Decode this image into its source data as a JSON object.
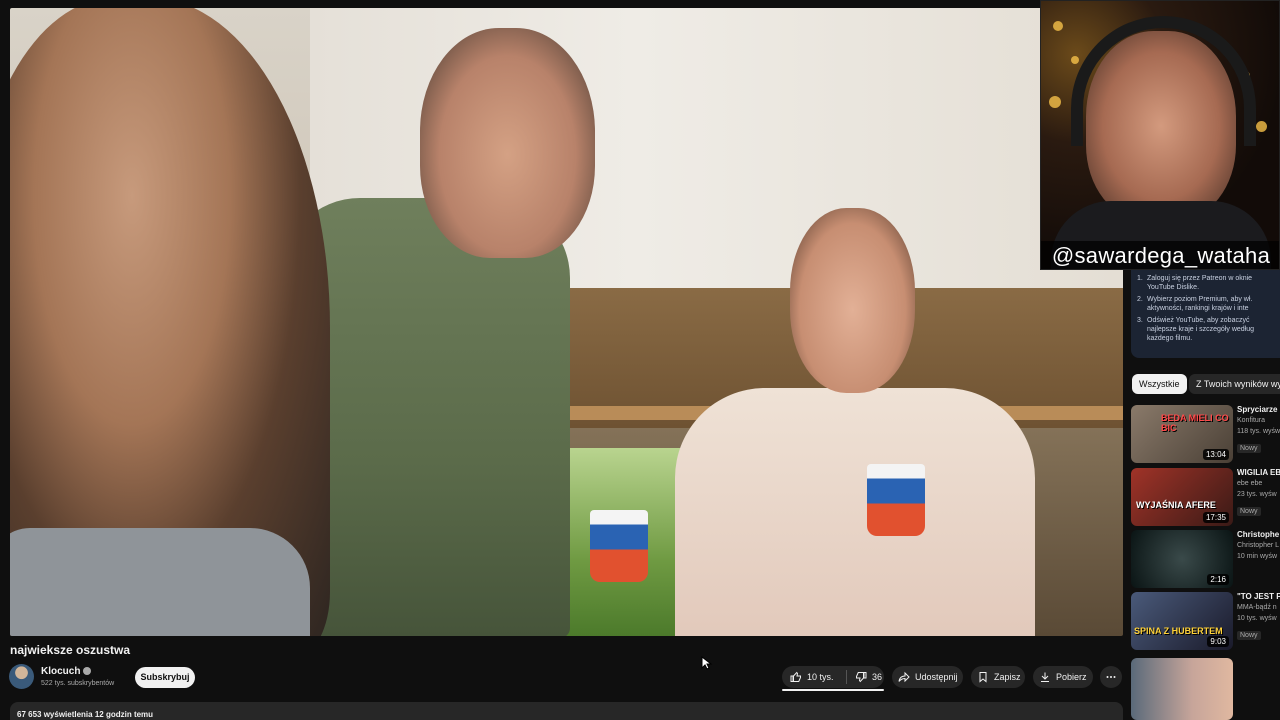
{
  "video": {
    "title": "najwieksze oszustwa",
    "channel": {
      "name": "Klocuch",
      "subscribers": "522 tys. subskrybentów",
      "subscribe_label": "Subskrybuj"
    },
    "likes": "10 tys.",
    "dislikes": "36",
    "share_label": "Udostępnij",
    "save_label": "Zapisz",
    "download_label": "Pobierz",
    "stats": "67 653 wyświetlenia  12 godzin temu"
  },
  "webcam": {
    "handle": "@sawardega_wataha"
  },
  "info_panel": {
    "items": [
      {
        "num": "1.",
        "text": "Zaloguj się przez Patreon w oknie YouTube Dislike."
      },
      {
        "num": "2.",
        "text": "Wybierz poziom Premium, aby wł. aktywności, rankingi krajów i inte"
      },
      {
        "num": "3.",
        "text": "Odśwież YouTube, aby zobaczyć najlepsze kraje i szczegóły według każdego filmu."
      }
    ]
  },
  "chips": {
    "active": "Wszystkie",
    "other": "Z Twoich wyników wys"
  },
  "suggestions": [
    {
      "title": "Spryciarze",
      "channel": "Konfitura",
      "views": "118 tys. wyśw",
      "badge": "Nowy",
      "duration": "13:04",
      "overlay": "BEDA MIELI CO BIC",
      "color": "#6a5a4a"
    },
    {
      "title": "WIGILIA EB",
      "channel": "ebe ebe",
      "views": "23 tys. wyśw",
      "badge": "Nowy",
      "duration": "17:35",
      "overlay": "WYJAŚNIA AFERE",
      "color": "#7a2a22"
    },
    {
      "title": "Christophe",
      "channel": "Christopher L",
      "views": "10 min wyśw",
      "badge": "",
      "duration": "2:16",
      "overlay": "",
      "color": "#1b2a2a"
    },
    {
      "title": "\"TO JEST P WŁODARCZ",
      "channel": "MMA-bądź n",
      "views": "10 tys. wyśw",
      "badge": "Nowy",
      "duration": "9:03",
      "overlay": "SPINA Z HUBERTEM",
      "color": "#2a3a5a"
    }
  ],
  "colors": {
    "background": "#0f0f0f",
    "pill": "#272727",
    "text": "#f1f1f1",
    "muted": "#aaaaaa"
  }
}
